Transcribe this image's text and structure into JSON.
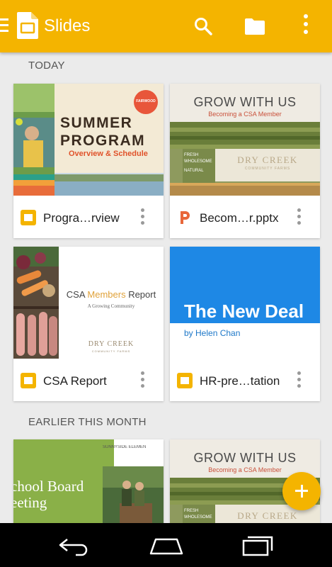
{
  "app": {
    "title": "Slides",
    "accent_color": "#f4b400"
  },
  "toolbar": {
    "menu_icon": "hamburger-icon",
    "search_icon": "search-icon",
    "folder_icon": "folder-icon",
    "overflow_icon": "more-vert-icon"
  },
  "sections": [
    {
      "title": "TODAY",
      "files": [
        {
          "name": "Progra…rview",
          "type_icon": "slides-icon",
          "thumb": {
            "title_line1": "SUMMER",
            "title_line2": "PROGRAM",
            "subtitle": "Overview & Schedule",
            "badge": "FAIRWOOD"
          }
        },
        {
          "name": "Becom…r.pptx",
          "type_icon": "powerpoint-icon",
          "thumb": {
            "title": "GROW WITH US",
            "subtitle": "Becoming a CSA Member",
            "tag_line1": "FRESH",
            "tag_line2": "WHOLESOME",
            "tag_line3": "NATURAL",
            "brand": "DRY CREEK",
            "brand_sub": "COMMUNITY FARMS"
          }
        },
        {
          "name": "CSA Report",
          "type_icon": "slides-icon",
          "thumb": {
            "title_part1": "CSA ",
            "title_part2": "Members",
            "title_part3": " Report",
            "subtitle": "A Growing Community",
            "brand": "DRY CREEK",
            "brand_sub": "COMMUNITY FARMS"
          }
        },
        {
          "name": "HR-pre…tation",
          "type_icon": "slides-icon",
          "thumb": {
            "title": "The New Deal",
            "byline": "by Helen Chan"
          }
        }
      ]
    },
    {
      "title": "EARLIER THIS MONTH",
      "files": [
        {
          "thumb": {
            "title_line1": "chool Board",
            "title_line2": "eeting",
            "school": "SUNNYSIDE ELEMEN"
          }
        },
        {
          "thumb": {
            "title": "GROW WITH US",
            "subtitle": "Becoming a CSA Member",
            "tag_line1": "FRESH",
            "tag_line2": "WHOLESOME",
            "brand": "DRY CREEK"
          }
        }
      ]
    }
  ],
  "fab": {
    "icon": "add-icon"
  },
  "navigation_bar": {
    "back_icon": "back-icon",
    "home_icon": "home-icon",
    "recents_icon": "recents-icon"
  }
}
